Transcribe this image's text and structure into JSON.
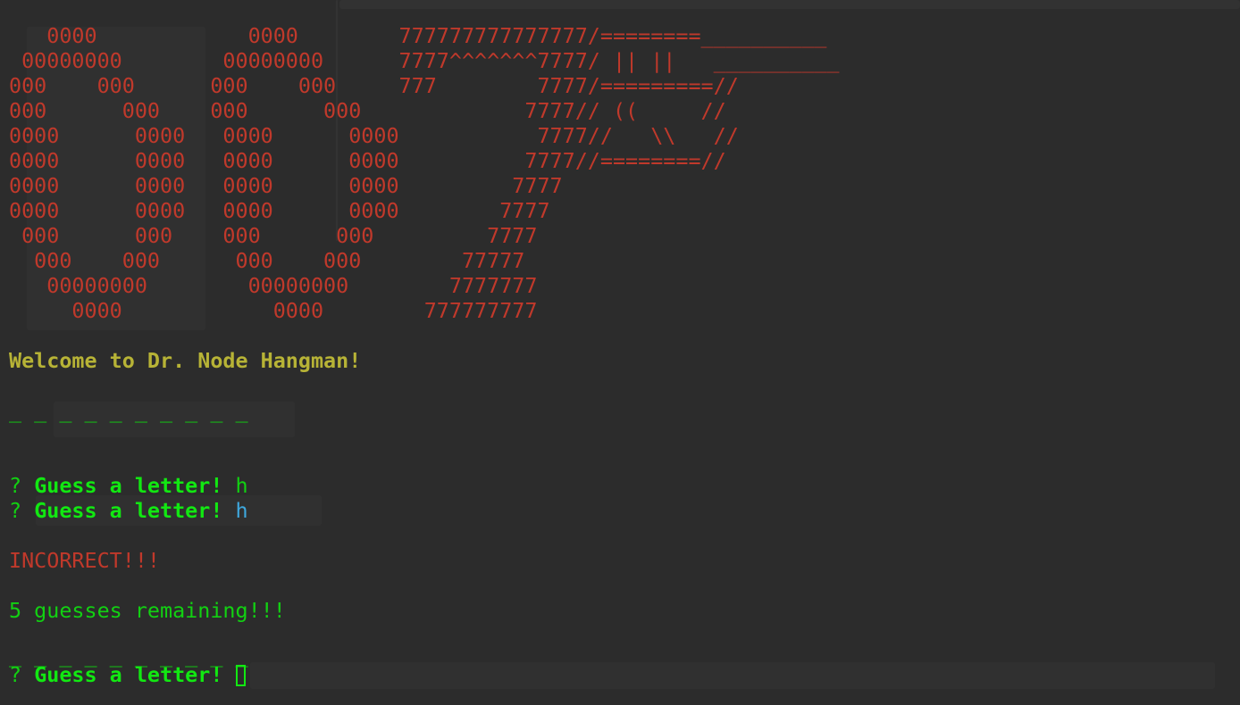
{
  "ascii_art": [
    "   0000            0000        777777777777777/========__________",
    " 00000000        00000000      7777^^^^^^^7777/ || ||   __________",
    "000    000      000    000     777        7777/=========//",
    "000      000    000      000             7777// ((     //",
    "0000      0000   0000      0000           7777//   \\\\   //",
    "0000      0000   0000      0000          7777//========//",
    "0000      0000   0000      0000         7777",
    "0000      0000   0000      0000        7777",
    " 000      000    000      000         7777",
    "  000    000      000    000        77777",
    "   00000000        00000000        7777777",
    "     0000            0000        777777777"
  ],
  "welcome": "Welcome to Dr. Node Hangman!",
  "word_blanks_initial": "_ _ _ _ _ _ _ _ _ _",
  "prompts": [
    {
      "mark": "?",
      "label": "Guess a letter!",
      "answer": "h"
    },
    {
      "mark": "?",
      "label": "Guess a letter!",
      "answer": "h"
    }
  ],
  "result": "INCORRECT!!!",
  "remaining": "5 guesses remaining!!!",
  "word_blanks_current": "_ _ _ _ _ _ _ _ _ _",
  "current_prompt": {
    "mark": "?",
    "label": "Guess a letter!"
  },
  "colors": {
    "background": "#2c2c2c",
    "art": "#c0392b",
    "welcome": "#b7b336",
    "prompt": "#12e812",
    "echo": "#3ea8de",
    "error": "#c0392b"
  }
}
